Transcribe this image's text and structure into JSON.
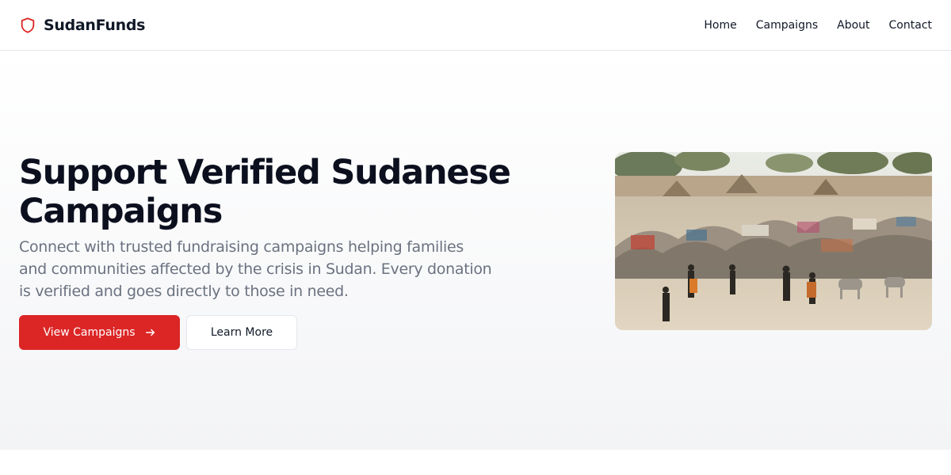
{
  "header": {
    "brand": "SudanFunds",
    "brand_icon": "shield-icon",
    "brand_color": "#dc2626",
    "nav": [
      "Home",
      "Campaigns",
      "About",
      "Contact"
    ]
  },
  "hero": {
    "title_line1": "Support Verified Sudanese",
    "title_line2": "Campaigns",
    "subtitle": "Connect with trusted fundraising campaigns helping families and communities affected by the crisis in Sudan. Every donation is verified and goes directly to those in need.",
    "primary_button": "View Campaigns",
    "primary_icon": "arrow-right-icon",
    "secondary_button": "Learn More",
    "image_icon": "camp-photo"
  },
  "colors": {
    "accent": "#dc2626",
    "text": "#111827",
    "muted": "#6b7280"
  }
}
